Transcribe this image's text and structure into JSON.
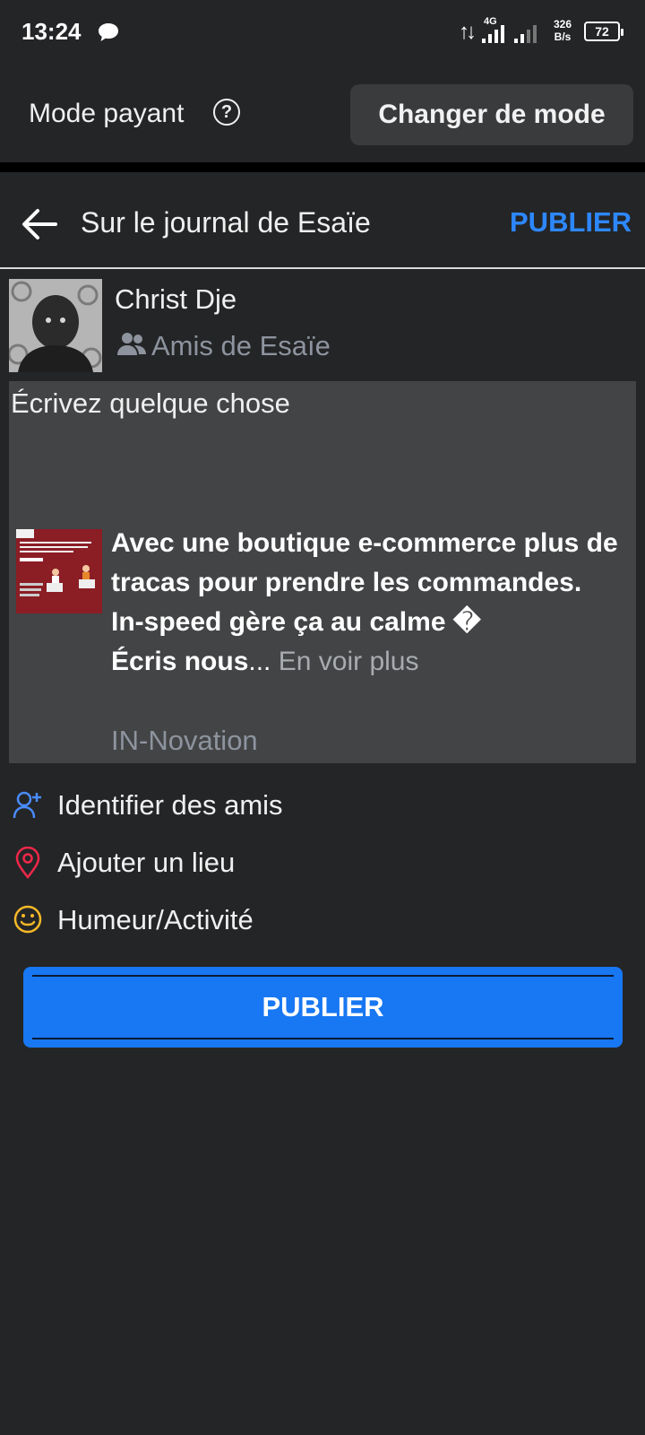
{
  "status_bar": {
    "time": "13:24",
    "network": "4G",
    "speed_value": "326",
    "speed_unit": "B/s",
    "battery": "72"
  },
  "mode_bar": {
    "label": "Mode payant",
    "help_icon": "question-circle-icon",
    "change_button": "Changer de mode"
  },
  "header": {
    "back_icon": "arrow-left-icon",
    "title": "Sur le journal de Esaïe",
    "publish": "PUBLIER"
  },
  "author": {
    "name": "Christ Dje",
    "audience_icon": "friends-icon",
    "audience": "Amis de Esaïe"
  },
  "composer": {
    "placeholder": "Écrivez quelque chose",
    "shared_post": {
      "line1": "Avec une boutique e-commerce plus de tracas pour prendre les commandes.",
      "line2": "In-speed gère ça au calme �",
      "line3": "Écris nous",
      "ellipsis": "...",
      "see_more": "En voir plus",
      "source": "IN-Novation"
    }
  },
  "options": [
    {
      "icon": "tag-friend-icon",
      "label": "Identifier des amis",
      "color": "#4a8cff"
    },
    {
      "icon": "location-pin-icon",
      "label": "Ajouter un lieu",
      "color": "#f02849"
    },
    {
      "icon": "smiley-icon",
      "label": "Humeur/Activité",
      "color": "#f7b928"
    }
  ],
  "publish_button": "PUBLIER",
  "colors": {
    "background": "#242527",
    "accent": "#2d88ff",
    "button": "#1877f2",
    "composer": "#434446"
  }
}
